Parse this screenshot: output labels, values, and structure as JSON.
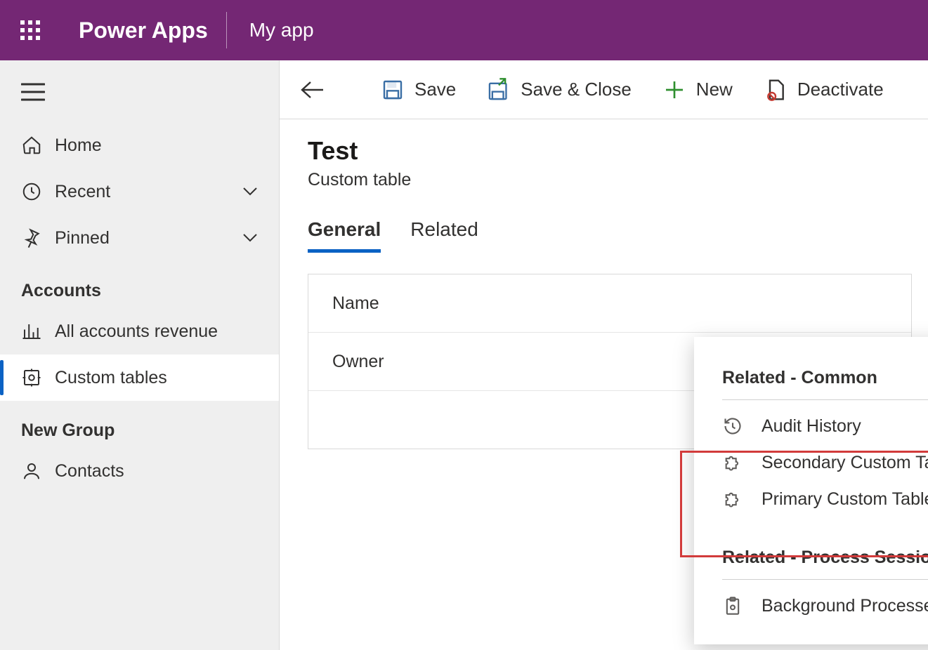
{
  "header": {
    "brand": "Power Apps",
    "app_name": "My app"
  },
  "sidebar": {
    "items": [
      {
        "icon": "home",
        "label": "Home",
        "hasChevron": false
      },
      {
        "icon": "clock",
        "label": "Recent",
        "hasChevron": true
      },
      {
        "icon": "pin",
        "label": "Pinned",
        "hasChevron": true
      }
    ],
    "groups": [
      {
        "title": "Accounts",
        "items": [
          {
            "icon": "chart",
            "label": "All accounts revenue",
            "active": false
          },
          {
            "icon": "table",
            "label": "Custom tables",
            "active": true
          }
        ]
      },
      {
        "title": "New Group",
        "items": [
          {
            "icon": "person",
            "label": "Contacts",
            "active": false
          }
        ]
      }
    ]
  },
  "toolbar": {
    "save": "Save",
    "saveClose": "Save & Close",
    "new": "New",
    "deactivate": "Deactivate"
  },
  "page": {
    "title": "Test",
    "subtitle": "Custom table",
    "tabs": [
      {
        "label": "General",
        "active": true
      },
      {
        "label": "Related",
        "active": false
      }
    ],
    "form": [
      {
        "label": "Name",
        "value": ""
      },
      {
        "label": "Owner",
        "value": ""
      },
      {
        "label": "",
        "value": ""
      }
    ]
  },
  "flyout": {
    "groups": [
      {
        "title": "Related - Common",
        "items": [
          {
            "icon": "history",
            "label": "Audit History"
          },
          {
            "icon": "puzzle",
            "label": "Secondary Custom Table Relationship"
          },
          {
            "icon": "puzzle",
            "label": "Primary Custom Table Relationship"
          }
        ]
      },
      {
        "title": "Related - Process Sessions",
        "items": [
          {
            "icon": "clipboard",
            "label": "Background Processes"
          }
        ]
      }
    ]
  }
}
